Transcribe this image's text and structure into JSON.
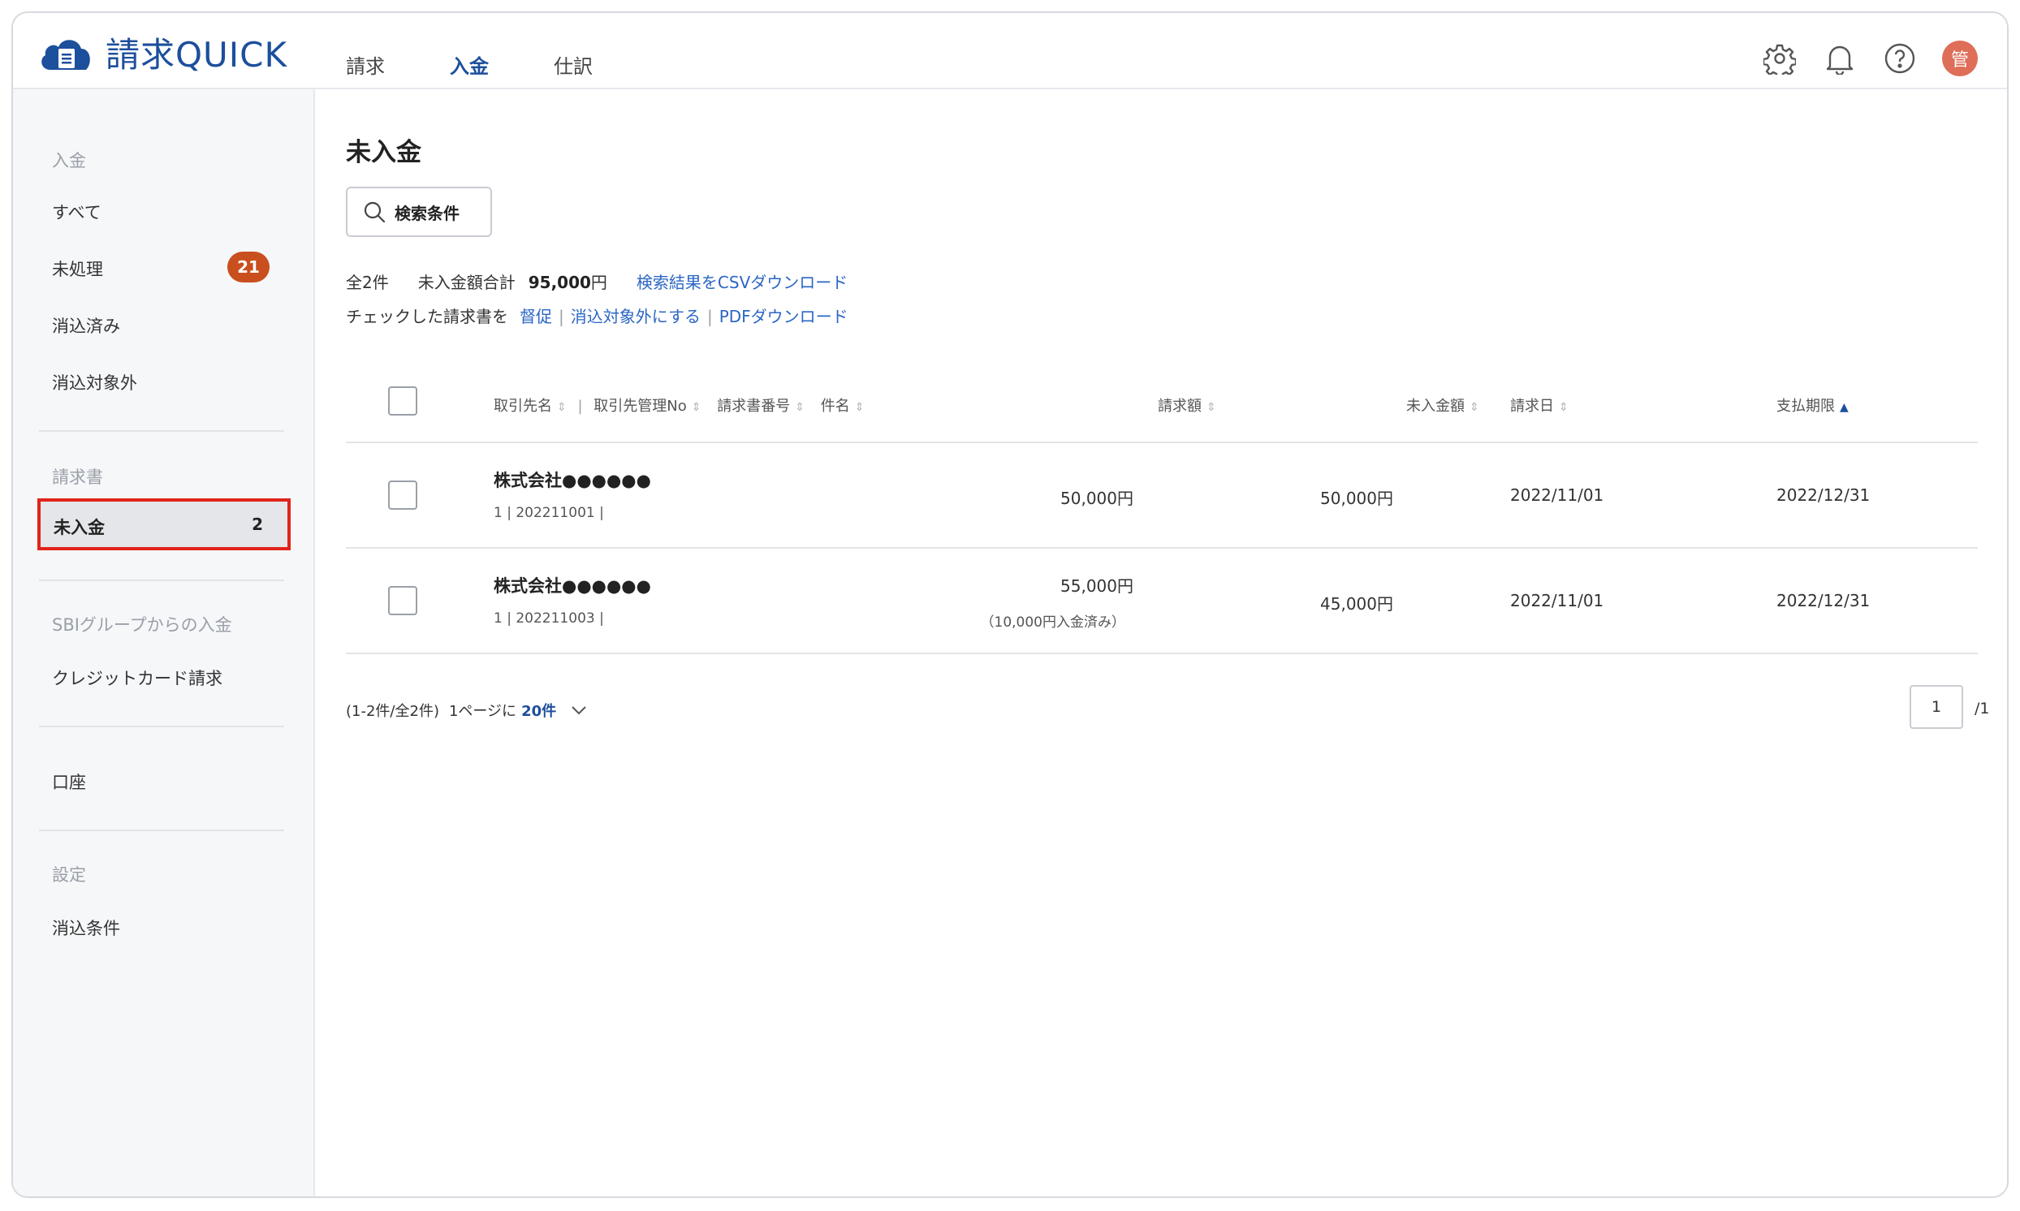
{
  "app": {
    "name": "請求QUICK"
  },
  "topnav": [
    {
      "label": "請求",
      "active": false
    },
    {
      "label": "入金",
      "active": true
    },
    {
      "label": "仕訳",
      "active": false
    }
  ],
  "header_icons": [
    "gear-icon",
    "bell-icon",
    "help-icon"
  ],
  "user": {
    "avatar_initial": "管",
    "avatar_color": "#de6e58"
  },
  "sidebar": {
    "section_payment": "入金",
    "all": "すべて",
    "unprocessed": "未処理",
    "unprocessed_count": "21",
    "reconciled": "消込済み",
    "excluded": "消込対象外",
    "section_invoice": "請求書",
    "unpaid": "未入金",
    "unpaid_count": "2",
    "section_sbi": "SBIグループからの入金",
    "credit_card": "クレジットカード請求",
    "account": "口座",
    "section_settings": "設定",
    "reconcile_conditions": "消込条件"
  },
  "main": {
    "title": "未入金",
    "search_button": "検索条件",
    "total_count": "全2件",
    "unpaid_total_label": "未入金額合計",
    "unpaid_total_amount": "95,000",
    "unpaid_total_unit": "円",
    "csv_link": "検索結果をCSVダウンロード",
    "checked_label": "チェックした請求書を",
    "action_remind": "督促",
    "action_exclude": "消込対象外にする",
    "action_pdf": "PDFダウンロード"
  },
  "table": {
    "headers": {
      "client_name": "取引先名",
      "client_no": "取引先管理No",
      "invoice_no": "請求書番号",
      "subject": "件名",
      "billed": "請求額",
      "unpaid": "未入金額",
      "issue_date": "請求日",
      "due_date": "支払期限"
    },
    "rows": [
      {
        "client_name": "株式会社●●●●●●",
        "meta": "1 | 202211001 |",
        "billed": "50,000円",
        "billed_note": "",
        "unpaid": "50,000円",
        "issue_date": "2022/11/01",
        "due_date": "2022/12/31"
      },
      {
        "client_name": "株式会社●●●●●●",
        "meta": "1 | 202211003 |",
        "billed": "55,000円",
        "billed_note": "（10,000円入金済み）",
        "unpaid": "45,000円",
        "issue_date": "2022/11/01",
        "due_date": "2022/12/31"
      }
    ]
  },
  "pagination": {
    "range": "(1-2件/全2件)",
    "per_page_label": "1ページに",
    "per_page_value": "20件",
    "current_page": "1",
    "total_pages": "/1"
  },
  "colors": {
    "brand": "#1c4f9c",
    "link": "#2b66c4",
    "badge": "#c94f1f",
    "highlight_border": "#e0241b"
  }
}
